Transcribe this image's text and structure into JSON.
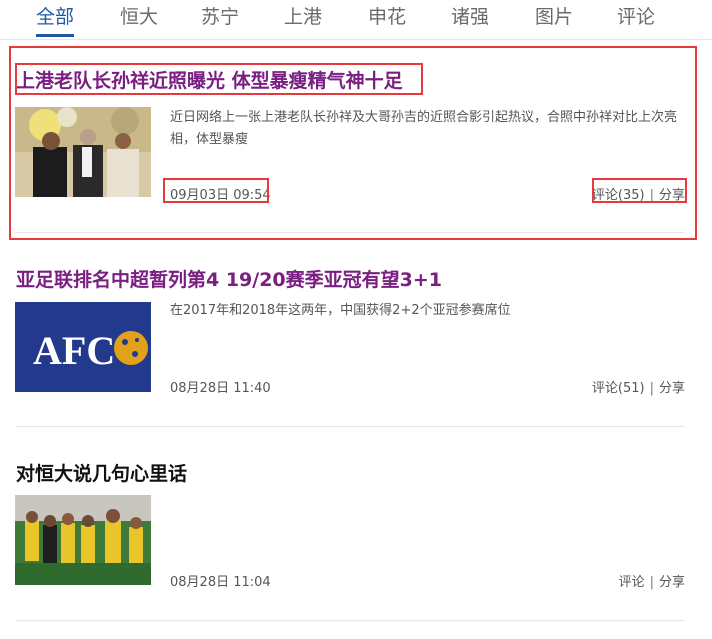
{
  "tabs": [
    "全部",
    "恒大",
    "苏宁",
    "上港",
    "申花",
    "诸强",
    "图片",
    "评论"
  ],
  "active_tab": "全部",
  "news": [
    {
      "title": "上港老队长孙祥近照曝光 体型暴瘦精气神十足",
      "title_color": "#7a1f82",
      "summary": "近日网络上一张上港老队长孙祥及大哥孙吉的近照合影引起热议，合照中孙祥对比上次亮相，体型暴瘦",
      "time": "09月03日 09:54",
      "comment_label": "评论(35)",
      "separator": "|",
      "share_label": "分享",
      "image": "photo-of-three-men"
    },
    {
      "title": "亚足联排名中超暂列第4 19/20赛季亚冠有望3+1",
      "title_color": "#7a1f82",
      "summary": "在2017年和2018年这两年，中国获得2+2个亚冠参赛席位",
      "time": "08月28日 11:40",
      "comment_label": "评论(51)",
      "separator": "|",
      "share_label": "分享",
      "image": "afc-logo",
      "image_text": "AFC"
    },
    {
      "title": "对恒大说几句心里话",
      "title_color": "#111111",
      "summary": "",
      "time": "08月28日 11:04",
      "comment_label": "评论",
      "separator": "|",
      "share_label": "分享",
      "image": "football-match-photo"
    }
  ],
  "colors": {
    "accent": "#1e5aa8",
    "highlight_box": "#e8393d",
    "visited_title": "#7a1f82"
  }
}
